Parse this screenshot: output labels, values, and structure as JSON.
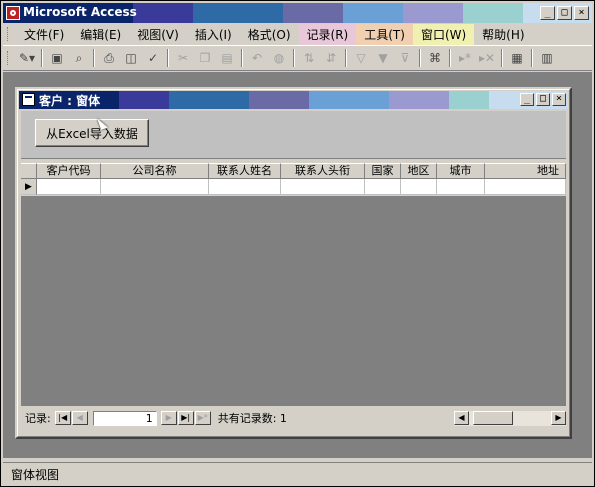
{
  "app": {
    "title": "Microsoft Access",
    "title_strip_colors": [
      "#0a246a",
      "#3a3a9a",
      "#2e6aa6",
      "#6a6aa6",
      "#6aa0d6",
      "#9a9ad0",
      "#9ad0d0",
      "#c8dcf0"
    ]
  },
  "window_buttons": {
    "minimize": "_",
    "restore": "□",
    "close": "×"
  },
  "menubar": {
    "items": [
      {
        "label": "文件(F)"
      },
      {
        "label": "编辑(E)"
      },
      {
        "label": "视图(V)"
      },
      {
        "label": "插入(I)"
      },
      {
        "label": "格式(O)"
      },
      {
        "label": "记录(R)"
      },
      {
        "label": "工具(T)"
      },
      {
        "label": "窗口(W)"
      },
      {
        "label": "帮助(H)"
      }
    ],
    "item_highlight_colors": [
      "",
      "",
      "",
      "",
      "",
      "#e8c8d8",
      "#f0d0b0",
      "#f0f0b0",
      ""
    ]
  },
  "toolbar": {
    "icons": [
      "design-view-icon",
      "save-icon",
      "search-icon",
      "print-icon",
      "print-preview-icon",
      "spelling-icon",
      "cut-icon",
      "copy-icon",
      "paste-icon",
      "undo-icon",
      "hyperlink-icon",
      "sort-ascending-icon",
      "sort-descending-icon",
      "filter-by-selection-icon",
      "filter-by-form-icon",
      "apply-filter-icon",
      "find-icon",
      "new-record-icon",
      "delete-record-icon",
      "properties-icon",
      "database-window-icon"
    ]
  },
  "form": {
    "title": "客户 : 窗体",
    "title_strip_colors": [
      "#0a246a",
      "#3a3a9a",
      "#2e6aa6",
      "#6a6aa6",
      "#6aa0d6",
      "#9a9ad0",
      "#9ad0d0",
      "#c8dcf0"
    ],
    "import_button_label": "从Excel导入数据",
    "columns": [
      "客户代码",
      "公司名称",
      "联系人姓名",
      "联系人头衔",
      "国家",
      "地区",
      "城市",
      "地址"
    ],
    "new_record_marker": "▶"
  },
  "navigator": {
    "label": "记录:",
    "current_record": "1",
    "total_label": "共有记录数: 1"
  },
  "statusbar": {
    "text": "窗体视图"
  }
}
